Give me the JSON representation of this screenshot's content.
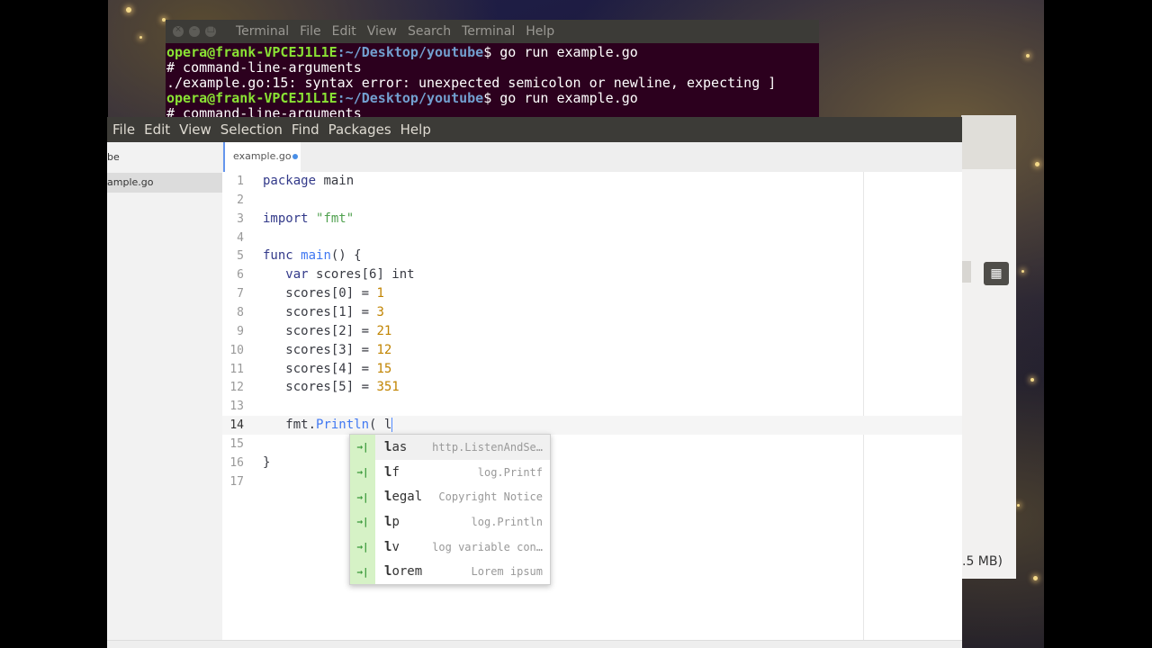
{
  "terminal": {
    "menu": [
      "Terminal",
      "File",
      "Edit",
      "View",
      "Search",
      "Terminal",
      "Help"
    ],
    "lines": [
      {
        "user": "opera@frank-VPCEJ1L1E",
        "path": ":~/Desktop/youtube",
        "cmd": "$ go run example.go"
      },
      {
        "text": "# command-line-arguments"
      },
      {
        "text": "./example.go:15: syntax error: unexpected semicolon or newline, expecting ]"
      },
      {
        "user": "opera@frank-VPCEJ1L1E",
        "path": ":~/Desktop/youtube",
        "cmd": "$ go run example.go"
      },
      {
        "text": "# command-line-arguments"
      }
    ]
  },
  "back_window": {
    "grid_icon": "grid-view-icon",
    "size_text": ".5 MB)"
  },
  "atom": {
    "menu": [
      "File",
      "Edit",
      "View",
      "Selection",
      "Find",
      "Packages",
      "Help"
    ],
    "tree": {
      "project": "be",
      "file": "ample.go"
    },
    "tab": {
      "title": "example.go",
      "modified": true
    },
    "code": [
      {
        "n": "1",
        "text": "package main"
      },
      {
        "n": "2",
        "text": ""
      },
      {
        "n": "3",
        "text": "import \"fmt\""
      },
      {
        "n": "4",
        "text": ""
      },
      {
        "n": "5",
        "text": "func main() {"
      },
      {
        "n": "6",
        "text": "   var scores[6] int"
      },
      {
        "n": "7",
        "text": "   scores[0] = 1"
      },
      {
        "n": "8",
        "text": "   scores[1] = 3"
      },
      {
        "n": "9",
        "text": "   scores[2] = 21"
      },
      {
        "n": "10",
        "text": "   scores[3] = 12"
      },
      {
        "n": "11",
        "text": "   scores[4] = 15"
      },
      {
        "n": "12",
        "text": "   scores[5] = 351"
      },
      {
        "n": "13",
        "text": ""
      },
      {
        "n": "14",
        "text": "   fmt.Println( l"
      },
      {
        "n": "15",
        "text": ""
      },
      {
        "n": "16",
        "text": "}"
      },
      {
        "n": "17",
        "text": ""
      }
    ],
    "cursor_line": "14",
    "autocomplete": [
      {
        "snippet": "las",
        "desc": "http.ListenAndSe…"
      },
      {
        "snippet": "lf",
        "desc": "log.Printf"
      },
      {
        "snippet": "legal",
        "desc": "Copyright Notice"
      },
      {
        "snippet": "lp",
        "desc": "log.Println"
      },
      {
        "snippet": "lv",
        "desc": "log variable con…"
      },
      {
        "snippet": "lorem",
        "desc": "Lorem ipsum"
      }
    ],
    "autocomplete_icon": "→|"
  }
}
